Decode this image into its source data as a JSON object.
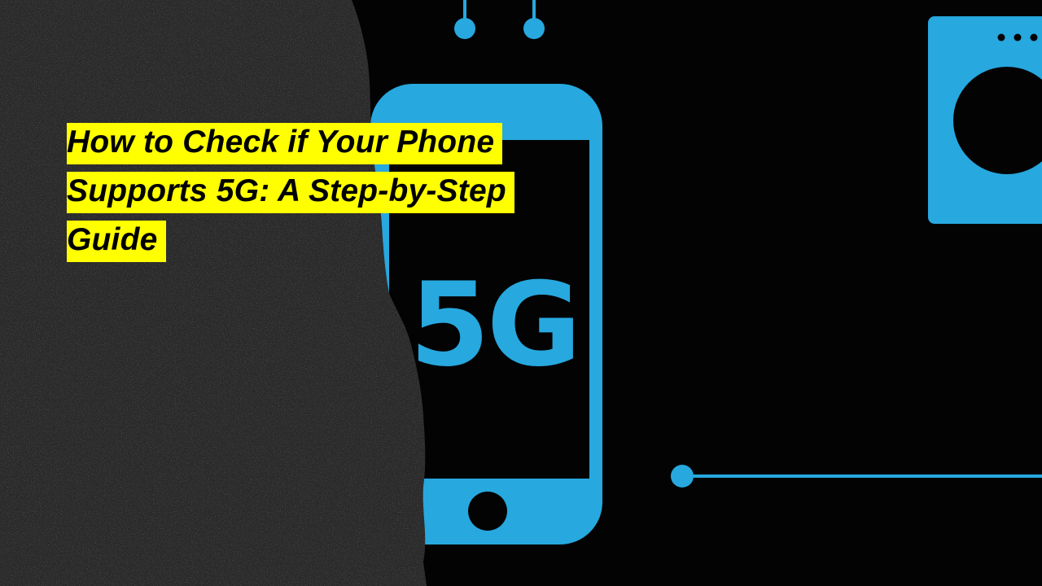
{
  "headline": "How to Check if Your Phone Supports 5G: A Step-by-Step Guide",
  "phone_badge": "5G",
  "icons": {
    "phone": "smartphone-icon",
    "connector": "network-node-icon",
    "washer": "washing-machine-icon"
  },
  "colors": {
    "accent": "#27a8df",
    "highlight": "#ffff00",
    "background": "#030303",
    "texture": "#2a2a2a"
  }
}
